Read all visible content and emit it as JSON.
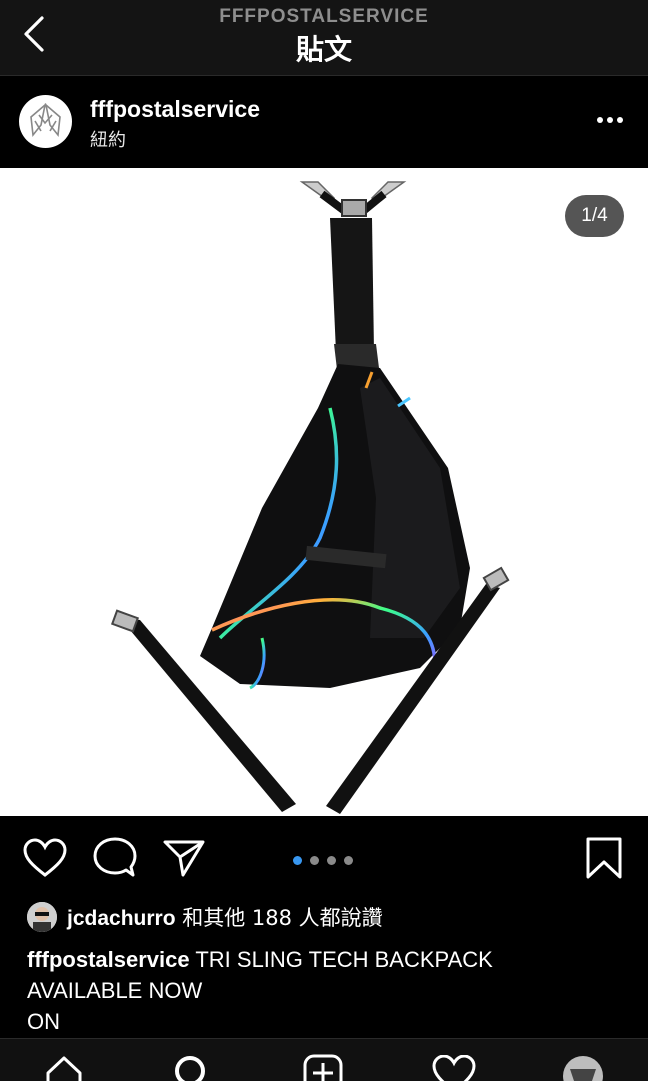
{
  "header": {
    "account_title": "FFFPOSTALSERVICE",
    "page_title": "貼文"
  },
  "post": {
    "username": "fffpostalservice",
    "location": "紐約",
    "image_counter": "1/4",
    "carousel_total": 4,
    "carousel_active": 1
  },
  "likes": {
    "user": "jcdachurro",
    "text": "和其他 188 人都說讚"
  },
  "caption": {
    "username": "fffpostalservice",
    "line1": "TRI SLING TECH BACKPACK",
    "line2": "AVAILABLE NOW",
    "line3": "ON"
  },
  "colors": {
    "background": "#000000",
    "topbar": "#141414",
    "active_dot": "#3897f0",
    "counter_bg": "#555555"
  },
  "icons": [
    "back-icon",
    "more-icon",
    "heart-icon",
    "comment-icon",
    "share-icon",
    "bookmark-icon",
    "home-icon",
    "search-icon",
    "add-icon",
    "activity-icon",
    "profile-icon"
  ]
}
